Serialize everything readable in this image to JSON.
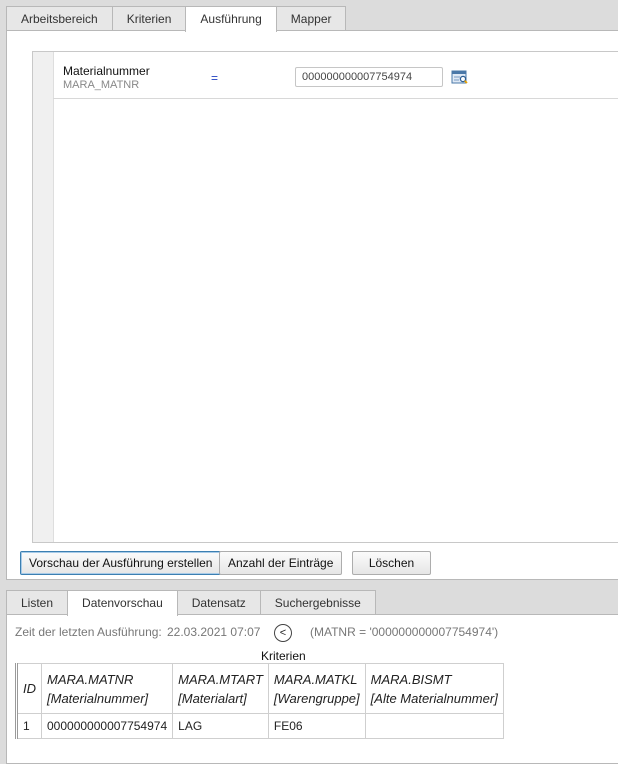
{
  "tabs_top": [
    "Arbeitsbereich",
    "Kriterien",
    "Ausführung",
    "Mapper"
  ],
  "criterion": {
    "name": "Materialnummer",
    "technical": "MARA_MATNR",
    "operator": "=",
    "value": "000000000007754974"
  },
  "buttons": {
    "preview": "Vorschau der Ausführung erstellen",
    "count": "Anzahl der Einträge",
    "delete": "Löschen"
  },
  "tabs_bottom": [
    "Listen",
    "Datenvorschau",
    "Datensatz",
    "Suchergebnisse"
  ],
  "execution": {
    "label": "Zeit der letzten Ausführung:",
    "time": "22.03.2021  07:07",
    "nav_icon": "<",
    "criteria_expr": "(MATNR = '000000000007754974')",
    "criteria_caption": "Kriterien"
  },
  "table": {
    "headers": [
      {
        "line1": "ID",
        "line2": ""
      },
      {
        "line1": "MARA.MATNR",
        "line2": "[Materialnummer]"
      },
      {
        "line1": "MARA.MTART",
        "line2": "[Materialart]"
      },
      {
        "line1": "MARA.MATKL",
        "line2": "[Warengruppe]"
      },
      {
        "line1": "MARA.BISMT",
        "line2": "[Alte Materialnummer]"
      }
    ],
    "rows": [
      [
        "1",
        "000000000007754974",
        "LAG",
        "FE06",
        ""
      ]
    ]
  },
  "colors": {
    "accent": "#3c7fb1",
    "operator": "#2040c0"
  }
}
